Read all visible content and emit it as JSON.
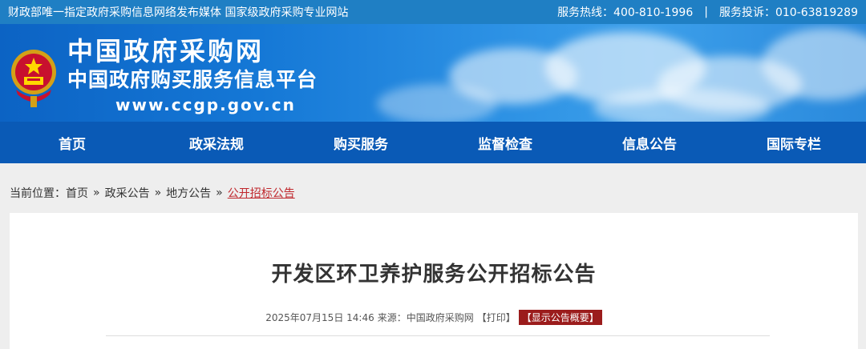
{
  "topbar": {
    "left_text": "财政部唯一指定政府采购信息网络发布媒体 国家级政府采购专业网站",
    "hotline": "服务热线：400-810-1996",
    "separator": "|",
    "complaint": "服务投诉：010-63819289"
  },
  "banner": {
    "emblem_icon": "national-emblem-icon",
    "logo_line1": "中国政府采购网",
    "logo_line2": "中国政府购买服务信息平台",
    "logo_url": "www.ccgp.gov.cn"
  },
  "nav": {
    "items": [
      {
        "label": "首页"
      },
      {
        "label": "政采法规"
      },
      {
        "label": "购买服务"
      },
      {
        "label": "监督检查"
      },
      {
        "label": "信息公告"
      },
      {
        "label": "国际专栏"
      }
    ]
  },
  "breadcrumb": {
    "prefix": "当前位置：",
    "items": [
      "首页",
      "政采公告",
      "地方公告"
    ],
    "arrow": "»",
    "current": "公开招标公告"
  },
  "article": {
    "title": "开发区环卫养护服务公开招标公告",
    "datetime": "2025年07月15日 14:46",
    "source": "来源：中国政府采购网",
    "print_label": "【打印】",
    "summary_label": "【显示公告概要】"
  },
  "colors": {
    "topbar": "#1f7fc4",
    "nav": "#0a5ab6",
    "accent_red": "#c0282d",
    "summary_bg": "#9b1c1c"
  }
}
